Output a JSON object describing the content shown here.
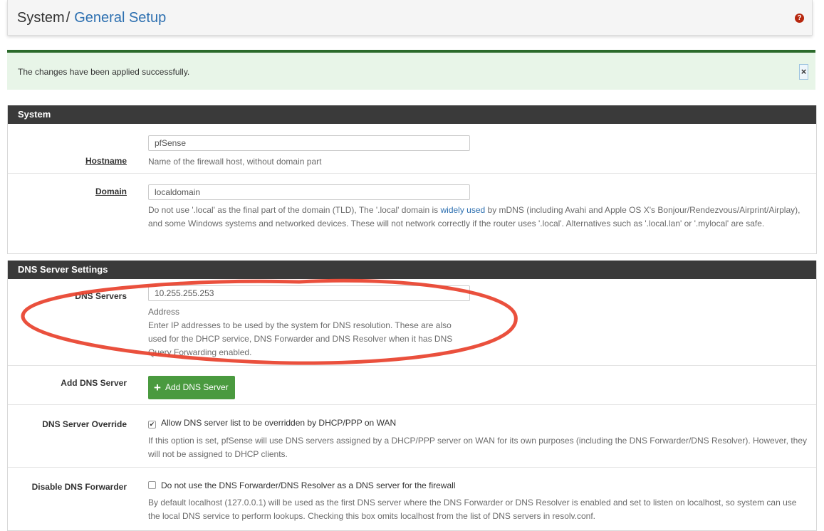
{
  "header": {
    "breadcrumb_root": "System",
    "breadcrumb_separator": "/",
    "breadcrumb_current": "General Setup",
    "help_icon": "question-circle-icon"
  },
  "alert": {
    "message": "The changes have been applied successfully.",
    "close_label": "×"
  },
  "system_panel": {
    "title": "System",
    "hostname": {
      "label": "Hostname",
      "value": "pfSense",
      "help": "Name of the firewall host, without domain part"
    },
    "domain": {
      "label": "Domain",
      "value": "localdomain",
      "help_part1": "Do not use '.local' as the final part of the domain (TLD), The '.local' domain is ",
      "help_link": "widely used",
      "help_part2": " by mDNS (including Avahi and Apple OS X's Bonjour/Rendezvous/Airprint/Airplay), and some Windows systems and networked devices. These will not network correctly if the router uses '.local'. Alternatives such as '.local.lan' or '.mylocal' are safe."
    }
  },
  "dns_panel": {
    "title": "DNS Server Settings",
    "dns_servers": {
      "label": "DNS Servers",
      "value": "10.255.255.253",
      "help_title": "Address",
      "help": "Enter IP addresses to be used by the system for DNS resolution. These are also used for the DHCP service, DNS Forwarder and DNS Resolver when it has DNS Query Forwarding enabled."
    },
    "add_dns": {
      "label": "Add DNS Server",
      "button_label": "Add DNS Server",
      "button_icon": "plus-icon"
    },
    "override": {
      "label": "DNS Server Override",
      "checked": true,
      "check_mark": "✔",
      "checkbox_label": "Allow DNS server list to be overridden by DHCP/PPP on WAN",
      "help": "If this option is set, pfSense will use DNS servers assigned by a DHCP/PPP server on WAN for its own purposes (including the DNS Forwarder/DNS Resolver). However, they will not be assigned to DHCP clients."
    },
    "disable_forwarder": {
      "label": "Disable DNS Forwarder",
      "checked": false,
      "checkbox_label": "Do not use the DNS Forwarder/DNS Resolver as a DNS server for the firewall",
      "help": "By default localhost (127.0.0.1) will be used as the first DNS server where the DNS Forwarder or DNS Resolver is enabled and set to listen on localhost, so system can use the local DNS service to perform lookups. Checking this box omits localhost from the list of DNS servers in resolv.conf."
    }
  },
  "colors": {
    "panel_heading": "#3a3a3a",
    "link": "#2c6fb0",
    "success_button": "#4a9a3f",
    "alert_border": "#2b6a2b",
    "alert_bg": "#e8f5e8",
    "annotation": "#e8412c"
  }
}
